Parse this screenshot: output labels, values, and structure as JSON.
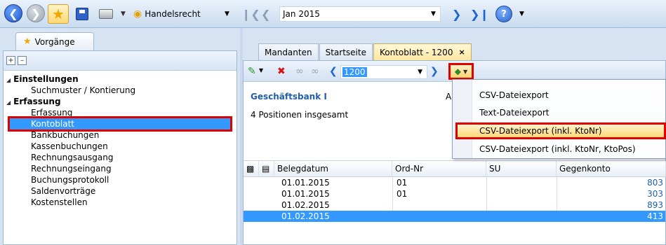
{
  "toolbar": {
    "area_label": "Handelsrecht",
    "period_value": "Jan 2015",
    "help_label": "?"
  },
  "left": {
    "tab_label": "Vorgänge",
    "tree": {
      "group1": "Einstellungen",
      "item_suchmuster": "Suchmuster / Kontierung",
      "group2": "Erfassung",
      "item_erfassung": "Erfassung",
      "item_kontoblatt": "Kontoblatt",
      "item_bankbuchungen": "Bankbuchungen",
      "item_kassenbuchungen": "Kassenbuchungen",
      "item_rechnungsausgang": "Rechnungsausgang",
      "item_rechnungseingang": "Rechnungseingang",
      "item_buchungsprotokoll": "Buchungsprotokoll",
      "item_saldenvortraege": "Saldenvorträge",
      "item_kostenstellen": "Kostenstellen"
    }
  },
  "tabs": {
    "mandanten": "Mandanten",
    "startseite": "Startseite",
    "kontoblatt": "Kontoblatt - 1200",
    "close": "×"
  },
  "right": {
    "account_value": "1200",
    "bank_name": "Geschäftsbank I",
    "bank_extra": "A",
    "count_text": "4 Positionen insgesamt"
  },
  "grid": {
    "headers": {
      "belegdatum": "Belegdatum",
      "ordnr": "Ord-Nr",
      "su": "SU",
      "gegenkonto": "Gegenkonto"
    },
    "rows": [
      {
        "datum": "01.01.2015",
        "ord": "01",
        "gegen": "803"
      },
      {
        "datum": "01.01.2015",
        "ord": "01",
        "gegen": "303"
      },
      {
        "datum": "01.02.2015",
        "ord": "",
        "gegen": "893"
      },
      {
        "datum": "01.02.2015",
        "ord": "",
        "gegen": "413"
      }
    ]
  },
  "menu": {
    "csv": "CSV-Dateiexport",
    "text": "Text-Dateiexport",
    "csv_ktonr": "CSV-Dateiexport (inkl. KtoNr)",
    "csv_ktonr_ktopos": "CSV-Dateiexport (inkl. KtoNr, KtoPos)"
  }
}
